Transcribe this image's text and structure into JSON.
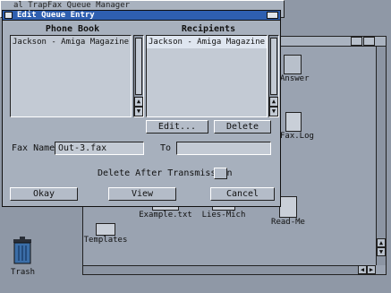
{
  "background_window": {
    "title": "al TrapFax Queue Manager"
  },
  "dialog": {
    "title": "Edit Queue Entry",
    "phone_book": {
      "header": "Phone Book",
      "items": [
        "Jackson - Amiga Magazine"
      ]
    },
    "recipients": {
      "header": "Recipients",
      "items": [
        "Jackson - Amiga Magazine"
      ]
    },
    "edit_label": "Edit...",
    "delete_label": "Delete",
    "fax_name_label": "Fax Name",
    "fax_name_value": "Out-3.fax",
    "to_label": "To",
    "to_value": "",
    "delete_after_label": "Delete After Transmission",
    "okay_label": "Okay",
    "view_label": "View",
    "cancel_label": "Cancel"
  },
  "drawer": {
    "icons": {
      "answer": "Answer",
      "fax_log": "Fax.Log",
      "templates": "Templates",
      "example": "Example.txt",
      "lies_mich": "Lies-Mich",
      "read_me": "Read-Me"
    }
  },
  "trash_label": "Trash"
}
